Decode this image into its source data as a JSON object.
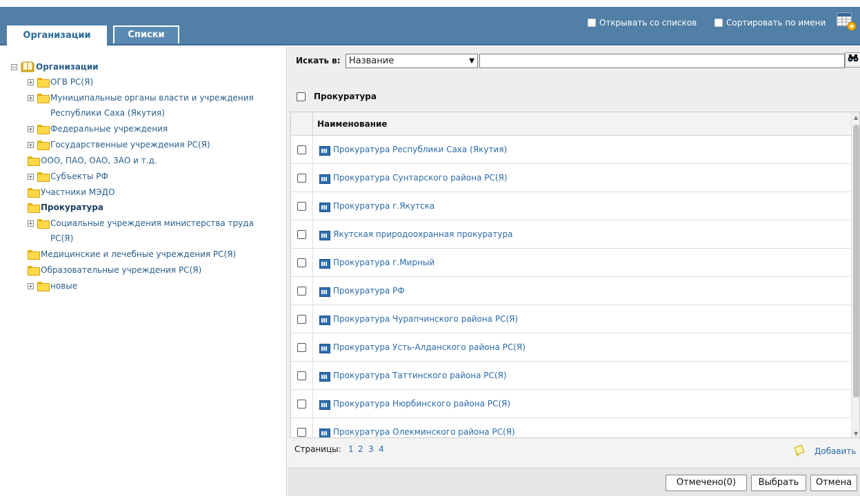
{
  "header": {
    "tabs": [
      {
        "label": "Организации",
        "active": true
      },
      {
        "label": "Списки",
        "active": false
      }
    ],
    "options": [
      {
        "label": "Открывать со списков",
        "checked": false
      },
      {
        "label": "Сортировать по имени",
        "checked": false
      }
    ],
    "settings_icon": "settings-grid-icon"
  },
  "tree": {
    "root": "Организации",
    "items": [
      {
        "label": "ОГВ РС(Я)",
        "expandable": true
      },
      {
        "label_line1": "Муниципальные органы власти и учреждения",
        "label_line2": "Республики Саха (Якутия)",
        "expandable": true
      },
      {
        "label": "Федеральные учреждения",
        "expandable": true
      },
      {
        "label": "Государственные учреждения РС(Я)",
        "expandable": true
      },
      {
        "label": "ООО, ПАО, ОАО, ЗАО и т.д.",
        "expandable": false
      },
      {
        "label": "Субъекты РФ",
        "expandable": true
      },
      {
        "label": "Участники МЭДО",
        "expandable": false
      },
      {
        "label": "Прокуратура",
        "expandable": false,
        "selected": true
      },
      {
        "label_line1": "Социальные учреждения министерства труда",
        "label_line2": "РС(Я)",
        "expandable": true
      },
      {
        "label": "Медицинские и лечебные учреждения РС(Я)",
        "expandable": false
      },
      {
        "label": "Образовательные учреждения РС(Я)",
        "expandable": false
      },
      {
        "label": "новые",
        "expandable": true
      }
    ]
  },
  "search": {
    "label": "Искать в:",
    "field": "Название",
    "query": ""
  },
  "group": {
    "title": "Прокуратура"
  },
  "table": {
    "column": "Наименование",
    "rows": [
      "Прокуратура Республики Саха (Якутия)",
      "Прокуратура Сунтарского района РС(Я)",
      "Прокуратура г.Якутска",
      "Якутская природоохранная прокуратура",
      "Прокуратура г.Мирный",
      "Прокуратура РФ",
      "Прокуратура Чурапчинского района РС(Я)",
      "Прокуратура Усть-Алданского района РС(Я)",
      "Прокуратура Таттинского района РС(Я)",
      "Прокуратура Нюрбинского района РС(Я)",
      "Прокуратура Олекминского района РС(Я)"
    ]
  },
  "pager": {
    "label": "Страницы:",
    "pages": [
      "1",
      "2",
      "3",
      "4"
    ],
    "add_label": "Добавить"
  },
  "footer": {
    "marked": "Отмечено(0)",
    "select": "Выбрать",
    "cancel": "Отмена"
  },
  "colors": {
    "header_bg": "#527fa6",
    "link": "#2a6aa8",
    "tree_text": "#2a5d8a"
  }
}
